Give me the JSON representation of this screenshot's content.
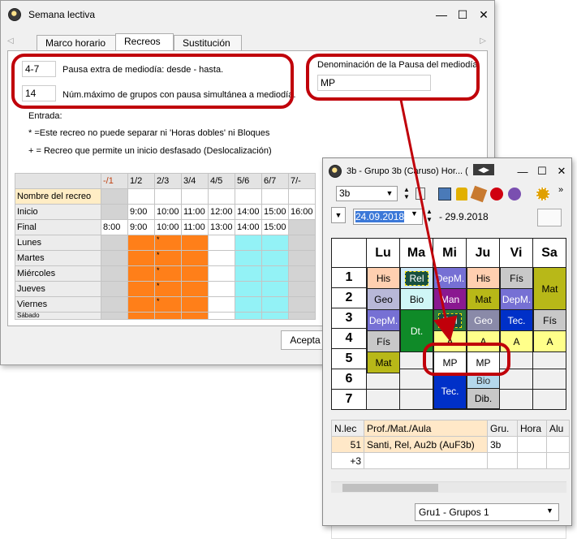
{
  "win1": {
    "title": "Semana lectiva",
    "tabs": [
      "Marco horario",
      "Recreos",
      "Sustitución"
    ],
    "extra_break_value": "4-7",
    "extra_break_label": "Pausa extra de mediodía: desde - hasta.",
    "max_groups_value": "14",
    "max_groups_label": "Núm.máximo de grupos con pausa simultánea a mediodía.",
    "denom_label": "Denominación de la Pausa del mediodía",
    "denom_value": "MP",
    "entry_label": "Entrada:",
    "entry_line1": "* =Este recreo no puede separar ni 'Horas dobles' ni Bloques",
    "entry_line2": "+ = Recreo que permite un inicio desfasado (Deslocalización)",
    "grid_headers": [
      "",
      "-/1",
      "1/2",
      "2/3",
      "3/4",
      "4/5",
      "5/6",
      "6/7",
      "7/-"
    ],
    "grid_rows": [
      {
        "label": "Nombre del recreo",
        "cells": [
          "",
          "",
          "",
          "",
          "",
          "",
          "",
          ""
        ]
      },
      {
        "label": "Inicio",
        "cells": [
          "",
          "9:00",
          "10:00",
          "11:00",
          "12:00",
          "14:00",
          "15:00",
          "16:00"
        ]
      },
      {
        "label": "Final",
        "cells": [
          "8:00",
          "9:00",
          "10:00",
          "11:00",
          "13:00",
          "14:00",
          "15:00",
          ""
        ]
      },
      {
        "label": "Lunes",
        "cells": [
          "",
          "",
          "*",
          "",
          "",
          "",
          "",
          ""
        ]
      },
      {
        "label": "Martes",
        "cells": [
          "",
          "",
          "*",
          "",
          "",
          "",
          "",
          ""
        ]
      },
      {
        "label": "Miércoles",
        "cells": [
          "",
          "",
          "*",
          "",
          "",
          "",
          "",
          ""
        ]
      },
      {
        "label": "Jueves",
        "cells": [
          "",
          "",
          "*",
          "",
          "",
          "",
          "",
          ""
        ]
      },
      {
        "label": "Viernes",
        "cells": [
          "",
          "",
          "*",
          "",
          "",
          "",
          "",
          ""
        ]
      },
      {
        "label": "Sábado",
        "cells": [
          "",
          "",
          "",
          "",
          "",
          "",
          "",
          ""
        ]
      }
    ],
    "accept_label": "Acepta"
  },
  "win2": {
    "title": "3b - Grupo 3b (Caruso) Hor... (",
    "class_select": "3b",
    "date_from": "24.09.2018",
    "date_to": "- 29.9.2018",
    "days": [
      "Lu",
      "Ma",
      "Mi",
      "Ju",
      "Vi",
      "Sa"
    ],
    "periods": [
      "1",
      "2",
      "3",
      "4",
      "5",
      "6",
      "7"
    ],
    "lessons": {
      "his1": "His",
      "rel": "Rel",
      "depm1": "DepM.",
      "his2": "His",
      "fis1": "Fís",
      "mat1": "Mat",
      "geo1": "Geo",
      "bio1": "Bio",
      "man": "Man",
      "mat2": "Mat",
      "depm2": "DepM.",
      "depm3": "DepM.",
      "rel2": "Rel",
      "geo2": "Geo",
      "tec1": "Tec.",
      "fis2": "Fís",
      "fis3": "Fís",
      "dt": "Dt.",
      "a1": "A",
      "a2": "A",
      "a3": "A",
      "a4": "A",
      "mat3": "Mat",
      "mp1": "MP",
      "mp2": "MP",
      "bio2": "Bio",
      "tec2": "Tec.",
      "dib": "Dib."
    },
    "low_headers": [
      "N.lec",
      "Prof./Mat./Aula",
      "Gru.",
      "Hora",
      "Alu"
    ],
    "low_row1": [
      "51",
      "Santi, Rel, Au2b (AuF3b)",
      "3b",
      "",
      ""
    ],
    "low_row2": [
      "+3",
      "",
      "",
      "",
      ""
    ],
    "group_select": "Gru1 - Grupos 1"
  },
  "colors": {
    "highlight": "#c0000a",
    "orange": "#ff7f19",
    "cyan": "#93f2f6"
  }
}
